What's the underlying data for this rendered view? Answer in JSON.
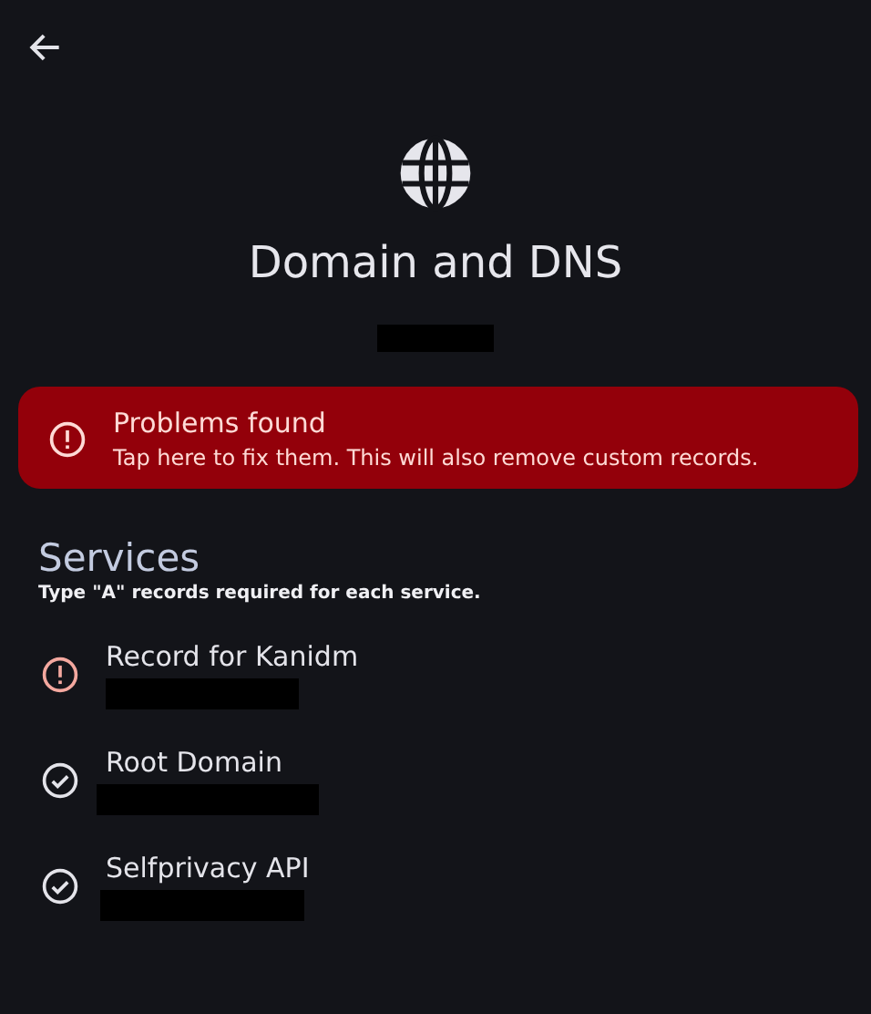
{
  "header": {
    "title": "Domain and DNS",
    "domain_redacted": true
  },
  "banner": {
    "title": "Problems found",
    "message": "Tap here to fix them. This will also remove custom records."
  },
  "services": {
    "title": "Services",
    "subtitle": "Type \"A\" records required for each service.",
    "records": [
      {
        "name": "Record for Kanidm",
        "kind": "error",
        "redacted": true
      },
      {
        "name": "Root Domain",
        "kind": "ok",
        "redacted": true
      },
      {
        "name": "Selfprivacy API",
        "kind": "ok",
        "redacted": true
      }
    ]
  }
}
